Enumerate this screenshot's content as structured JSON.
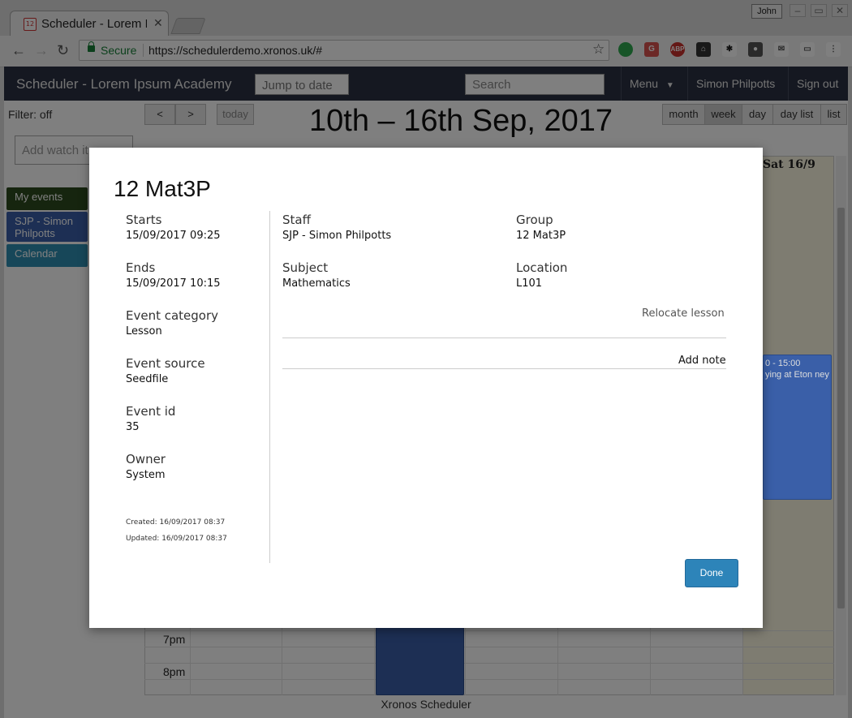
{
  "browser": {
    "tab_title": "Scheduler - Lorem Ipsum Academy",
    "user_badge": "John",
    "secure_label": "Secure",
    "url": "https://schedulerdemo.xronos.uk/#"
  },
  "app": {
    "title": "Scheduler - Lorem Ipsum Academy",
    "jump_placeholder": "Jump to date",
    "search_placeholder": "Search",
    "menu_label": "Menu",
    "user_name": "Simon Philpotts",
    "sign_out": "Sign out",
    "filter": "Filter: off",
    "watch_placeholder": "Add watch it",
    "calendars": [
      {
        "label": "My events",
        "color": "#2d4a1e"
      },
      {
        "label": "SJP - Simon Philpotts",
        "color": "#3a5fa8"
      },
      {
        "label": "Calendar",
        "color": "#2f8fb3"
      }
    ],
    "prev": "<",
    "next": ">",
    "today": "today",
    "range_title": "10th – 16th Sep, 2017",
    "views": [
      "month",
      "week",
      "day",
      "day list",
      "list"
    ],
    "active_view": "week",
    "sat_header": "Sat 16/9",
    "time_labels": [
      "7pm",
      "8pm"
    ],
    "event_time": "0 - 15:00",
    "event_text": "ying at Eton ney",
    "footer": "Xronos Scheduler"
  },
  "modal": {
    "title": "12 Mat3P",
    "starts_label": "Starts",
    "starts_value": "15/09/2017 09:25",
    "ends_label": "Ends",
    "ends_value": "15/09/2017 10:15",
    "category_label": "Event category",
    "category_value": "Lesson",
    "source_label": "Event source",
    "source_value": "Seedfile",
    "id_label": "Event id",
    "id_value": "35",
    "owner_label": "Owner",
    "owner_value": "System",
    "created": "Created: 16/09/2017 08:37",
    "updated": "Updated: 16/09/2017 08:37",
    "staff_label": "Staff",
    "staff_value": "SJP - Simon Philpotts",
    "group_label": "Group",
    "group_value": "12 Mat3P",
    "subject_label": "Subject",
    "subject_value": "Mathematics",
    "location_label": "Location",
    "location_value": "L101",
    "relocate": "Relocate lesson",
    "add_note": "Add note",
    "done": "Done"
  }
}
